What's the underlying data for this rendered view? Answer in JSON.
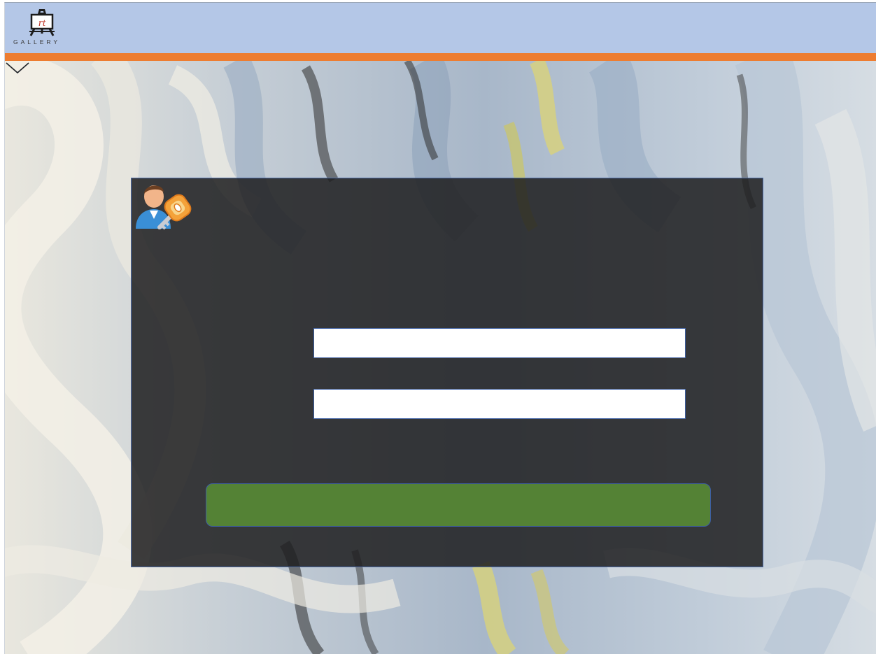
{
  "header": {
    "logo": {
      "monogram": "rt",
      "wordmark": "GALLERY",
      "icon": "easel-logo-icon"
    },
    "colors": {
      "header_bg": "#b4c7e7",
      "accent_line": "#ed7d31"
    }
  },
  "page": {
    "dropdown_icon": "chevron-down-icon"
  },
  "login": {
    "icon": "user-key-icon",
    "username_value": "",
    "password_value": "",
    "button_label": "",
    "colors": {
      "card_bg": "#1e1e20",
      "button_bg": "#548235",
      "border": "#3d5fa3"
    }
  }
}
